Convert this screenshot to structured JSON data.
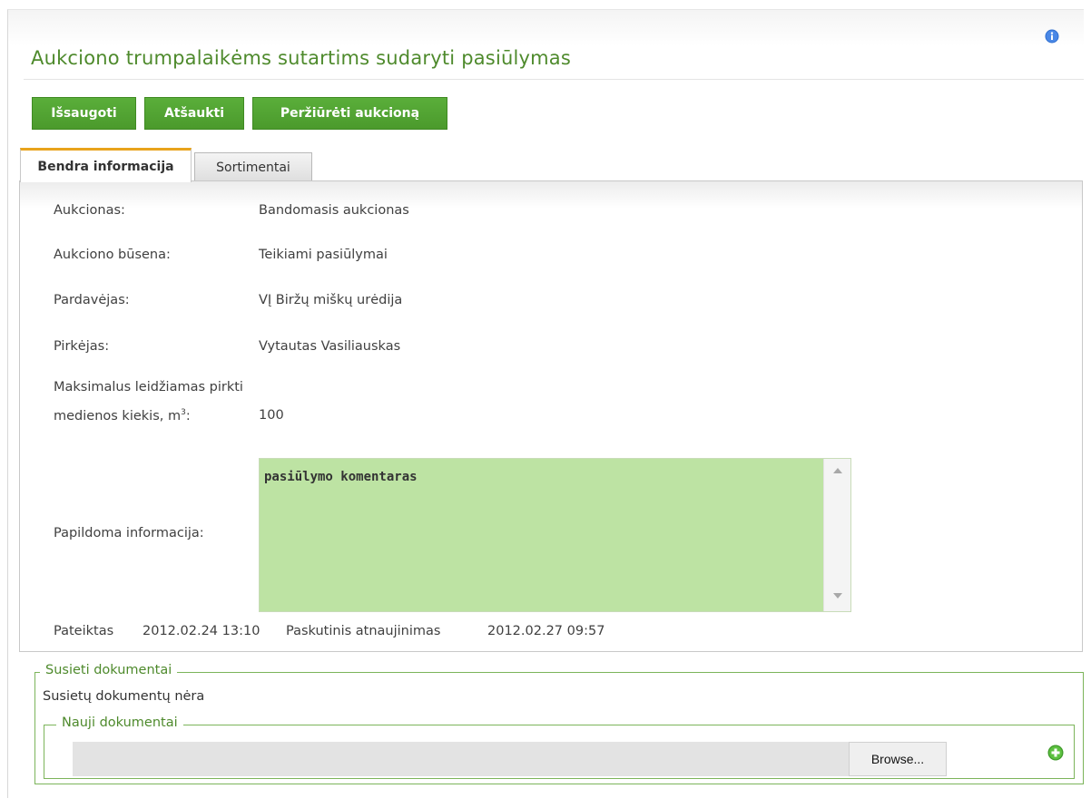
{
  "header": {
    "title": "Aukciono trumpalaikėms sutartims sudaryti pasiūlymas",
    "info_icon": "info-icon"
  },
  "toolbar": {
    "save_label": "Išsaugoti",
    "cancel_label": "Atšaukti",
    "view_label": "Peržiūrėti aukcioną"
  },
  "tabs": [
    {
      "label": "Bendra informacija",
      "active": true
    },
    {
      "label": "Sortimentai",
      "active": false
    }
  ],
  "form": {
    "auction_label": "Aukcionas:",
    "auction_value": "Bandomasis aukcionas",
    "status_label": "Aukciono būsena:",
    "status_value": "Teikiami pasiūlymai",
    "seller_label": "Pardavėjas:",
    "seller_value": "VĮ Biržų miškų urėdija",
    "buyer_label": "Pirkėjas:",
    "buyer_value": "Vytautas Vasiliauskas",
    "max_label": "Maksimalus leidžiamas pirkti medienos kiekis, m",
    "max_label_sup": "3",
    "max_label_suffix": ":",
    "max_value": "100",
    "extra_label": "Papildoma informacija:",
    "extra_value": "pasiūlymo komentaras"
  },
  "meta": {
    "submitted_label": "Pateiktas",
    "submitted_value": "2012.02.24 13:10",
    "updated_label": "Paskutinis atnaujinimas",
    "updated_value": "2012.02.27 09:57"
  },
  "documents": {
    "linked_legend": "Susieti dokumentai",
    "no_docs_text": "Susietų dokumentų nėra",
    "new_legend": "Nauji dokumentai",
    "browse_label": "Browse...",
    "add_icon": "plus-circle-icon"
  },
  "colors": {
    "accent": "#4e8a2c",
    "button": "#5aae3a",
    "textarea_bg": "#bde3a3",
    "tab_accent": "#e8a31c"
  }
}
